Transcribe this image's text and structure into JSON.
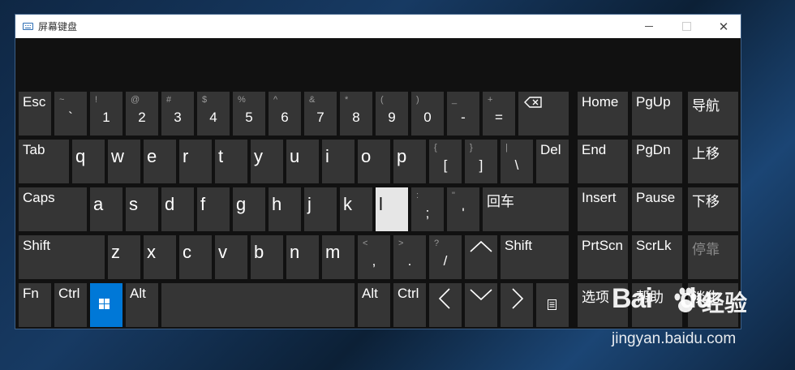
{
  "window": {
    "title": "屏幕键盘",
    "minimize_glyph": "",
    "close_glyph": "✕"
  },
  "keys": {
    "esc": "Esc",
    "tilde": {
      "top": "~",
      "bottom": "`"
    },
    "k1": {
      "top": "!",
      "bottom": "1"
    },
    "k2": {
      "top": "@",
      "bottom": "2"
    },
    "k3": {
      "top": "#",
      "bottom": "3"
    },
    "k4": {
      "top": "$",
      "bottom": "4"
    },
    "k5": {
      "top": "%",
      "bottom": "5"
    },
    "k6": {
      "top": "^",
      "bottom": "6"
    },
    "k7": {
      "top": "&",
      "bottom": "7"
    },
    "k8": {
      "top": "*",
      "bottom": "8"
    },
    "k9": {
      "top": "(",
      "bottom": "9"
    },
    "k0": {
      "top": ")",
      "bottom": "0"
    },
    "minus": {
      "top": "_",
      "bottom": "-"
    },
    "equal": {
      "top": "+",
      "bottom": "="
    },
    "backspace_icon": "backspace-icon",
    "home": "Home",
    "pgup": "PgUp",
    "nav": "导航",
    "tab": "Tab",
    "q": "q",
    "w": "w",
    "e": "e",
    "r": "r",
    "t": "t",
    "y": "y",
    "u": "u",
    "i": "i",
    "o": "o",
    "p": "p",
    "lbracket": {
      "top": "{",
      "bottom": "["
    },
    "rbracket": {
      "top": "}",
      "bottom": "]"
    },
    "pipe": {
      "top": "|",
      "bottom": "\\"
    },
    "del": "Del",
    "end": "End",
    "pgdn": "PgDn",
    "moveup": "上移",
    "caps": "Caps",
    "a": "a",
    "s": "s",
    "d": "d",
    "f": "f",
    "g": "g",
    "h": "h",
    "j": "j",
    "k": "k",
    "l": "l",
    "semicolon": {
      "top": ":",
      "bottom": ";"
    },
    "quote": {
      "top": "\"",
      "bottom": "'"
    },
    "enter": "回车",
    "insert": "Insert",
    "pause": "Pause",
    "movedown": "下移",
    "shift_left": "Shift",
    "z": "z",
    "x": "x",
    "c": "c",
    "v": "v",
    "b": "b",
    "n": "n",
    "m": "m",
    "comma": {
      "top": "<",
      "bottom": ","
    },
    "period": {
      "top": ">",
      "bottom": "."
    },
    "slash": {
      "top": "?",
      "bottom": "/"
    },
    "shift_right": "Shift",
    "prtscn": "PrtScn",
    "scrlk": "ScrLk",
    "dock": "停靠",
    "fn": "Fn",
    "ctrl_left": "Ctrl",
    "alt_left": "Alt",
    "alt_right": "Alt",
    "ctrl_right": "Ctrl",
    "options": "选项",
    "help": "帮助",
    "fade": "淡化"
  },
  "watermark": {
    "logo": "Bai",
    "logo2": "du",
    "cn": "经验",
    "url": "jingyan.baidu.com"
  },
  "colors": {
    "key_bg": "#353535",
    "active_key": "#e6e6e6",
    "windows_key": "#0078d7"
  }
}
